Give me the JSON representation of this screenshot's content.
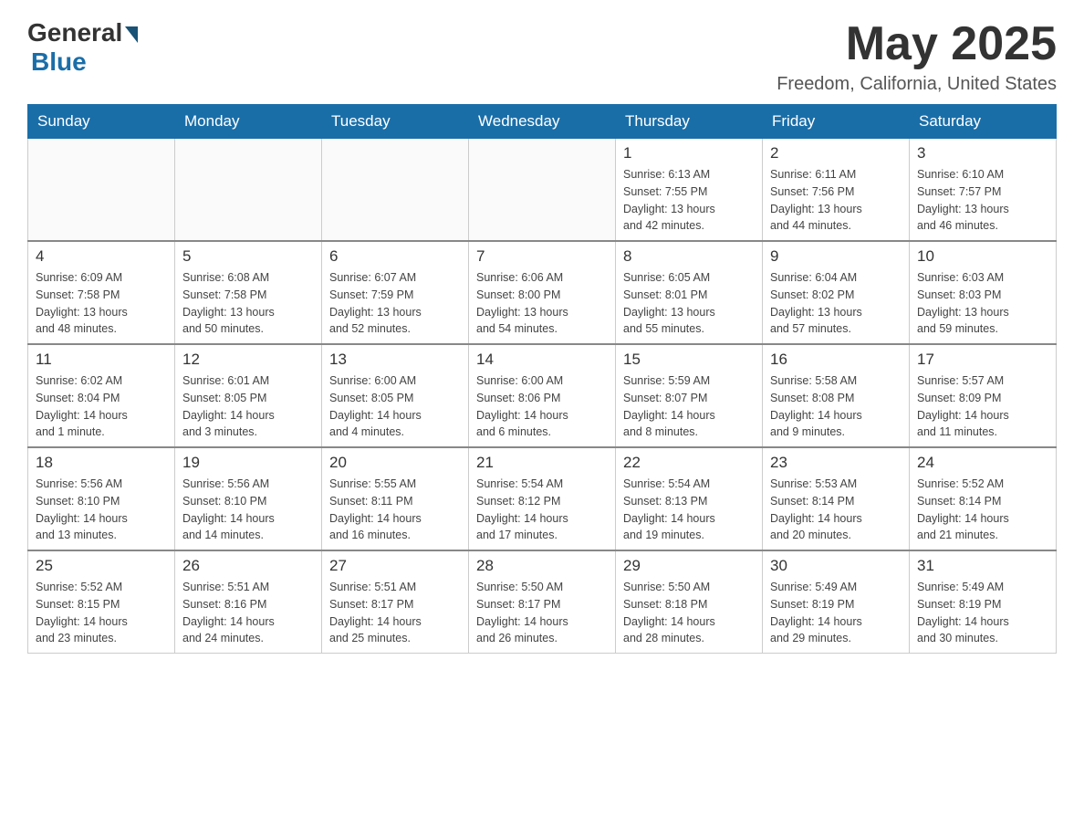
{
  "header": {
    "logo_general": "General",
    "logo_blue": "Blue",
    "month": "May 2025",
    "location": "Freedom, California, United States"
  },
  "days_of_week": [
    "Sunday",
    "Monday",
    "Tuesday",
    "Wednesday",
    "Thursday",
    "Friday",
    "Saturday"
  ],
  "weeks": [
    [
      {
        "day": "",
        "info": ""
      },
      {
        "day": "",
        "info": ""
      },
      {
        "day": "",
        "info": ""
      },
      {
        "day": "",
        "info": ""
      },
      {
        "day": "1",
        "info": "Sunrise: 6:13 AM\nSunset: 7:55 PM\nDaylight: 13 hours\nand 42 minutes."
      },
      {
        "day": "2",
        "info": "Sunrise: 6:11 AM\nSunset: 7:56 PM\nDaylight: 13 hours\nand 44 minutes."
      },
      {
        "day": "3",
        "info": "Sunrise: 6:10 AM\nSunset: 7:57 PM\nDaylight: 13 hours\nand 46 minutes."
      }
    ],
    [
      {
        "day": "4",
        "info": "Sunrise: 6:09 AM\nSunset: 7:58 PM\nDaylight: 13 hours\nand 48 minutes."
      },
      {
        "day": "5",
        "info": "Sunrise: 6:08 AM\nSunset: 7:58 PM\nDaylight: 13 hours\nand 50 minutes."
      },
      {
        "day": "6",
        "info": "Sunrise: 6:07 AM\nSunset: 7:59 PM\nDaylight: 13 hours\nand 52 minutes."
      },
      {
        "day": "7",
        "info": "Sunrise: 6:06 AM\nSunset: 8:00 PM\nDaylight: 13 hours\nand 54 minutes."
      },
      {
        "day": "8",
        "info": "Sunrise: 6:05 AM\nSunset: 8:01 PM\nDaylight: 13 hours\nand 55 minutes."
      },
      {
        "day": "9",
        "info": "Sunrise: 6:04 AM\nSunset: 8:02 PM\nDaylight: 13 hours\nand 57 minutes."
      },
      {
        "day": "10",
        "info": "Sunrise: 6:03 AM\nSunset: 8:03 PM\nDaylight: 13 hours\nand 59 minutes."
      }
    ],
    [
      {
        "day": "11",
        "info": "Sunrise: 6:02 AM\nSunset: 8:04 PM\nDaylight: 14 hours\nand 1 minute."
      },
      {
        "day": "12",
        "info": "Sunrise: 6:01 AM\nSunset: 8:05 PM\nDaylight: 14 hours\nand 3 minutes."
      },
      {
        "day": "13",
        "info": "Sunrise: 6:00 AM\nSunset: 8:05 PM\nDaylight: 14 hours\nand 4 minutes."
      },
      {
        "day": "14",
        "info": "Sunrise: 6:00 AM\nSunset: 8:06 PM\nDaylight: 14 hours\nand 6 minutes."
      },
      {
        "day": "15",
        "info": "Sunrise: 5:59 AM\nSunset: 8:07 PM\nDaylight: 14 hours\nand 8 minutes."
      },
      {
        "day": "16",
        "info": "Sunrise: 5:58 AM\nSunset: 8:08 PM\nDaylight: 14 hours\nand 9 minutes."
      },
      {
        "day": "17",
        "info": "Sunrise: 5:57 AM\nSunset: 8:09 PM\nDaylight: 14 hours\nand 11 minutes."
      }
    ],
    [
      {
        "day": "18",
        "info": "Sunrise: 5:56 AM\nSunset: 8:10 PM\nDaylight: 14 hours\nand 13 minutes."
      },
      {
        "day": "19",
        "info": "Sunrise: 5:56 AM\nSunset: 8:10 PM\nDaylight: 14 hours\nand 14 minutes."
      },
      {
        "day": "20",
        "info": "Sunrise: 5:55 AM\nSunset: 8:11 PM\nDaylight: 14 hours\nand 16 minutes."
      },
      {
        "day": "21",
        "info": "Sunrise: 5:54 AM\nSunset: 8:12 PM\nDaylight: 14 hours\nand 17 minutes."
      },
      {
        "day": "22",
        "info": "Sunrise: 5:54 AM\nSunset: 8:13 PM\nDaylight: 14 hours\nand 19 minutes."
      },
      {
        "day": "23",
        "info": "Sunrise: 5:53 AM\nSunset: 8:14 PM\nDaylight: 14 hours\nand 20 minutes."
      },
      {
        "day": "24",
        "info": "Sunrise: 5:52 AM\nSunset: 8:14 PM\nDaylight: 14 hours\nand 21 minutes."
      }
    ],
    [
      {
        "day": "25",
        "info": "Sunrise: 5:52 AM\nSunset: 8:15 PM\nDaylight: 14 hours\nand 23 minutes."
      },
      {
        "day": "26",
        "info": "Sunrise: 5:51 AM\nSunset: 8:16 PM\nDaylight: 14 hours\nand 24 minutes."
      },
      {
        "day": "27",
        "info": "Sunrise: 5:51 AM\nSunset: 8:17 PM\nDaylight: 14 hours\nand 25 minutes."
      },
      {
        "day": "28",
        "info": "Sunrise: 5:50 AM\nSunset: 8:17 PM\nDaylight: 14 hours\nand 26 minutes."
      },
      {
        "day": "29",
        "info": "Sunrise: 5:50 AM\nSunset: 8:18 PM\nDaylight: 14 hours\nand 28 minutes."
      },
      {
        "day": "30",
        "info": "Sunrise: 5:49 AM\nSunset: 8:19 PM\nDaylight: 14 hours\nand 29 minutes."
      },
      {
        "day": "31",
        "info": "Sunrise: 5:49 AM\nSunset: 8:19 PM\nDaylight: 14 hours\nand 30 minutes."
      }
    ]
  ]
}
